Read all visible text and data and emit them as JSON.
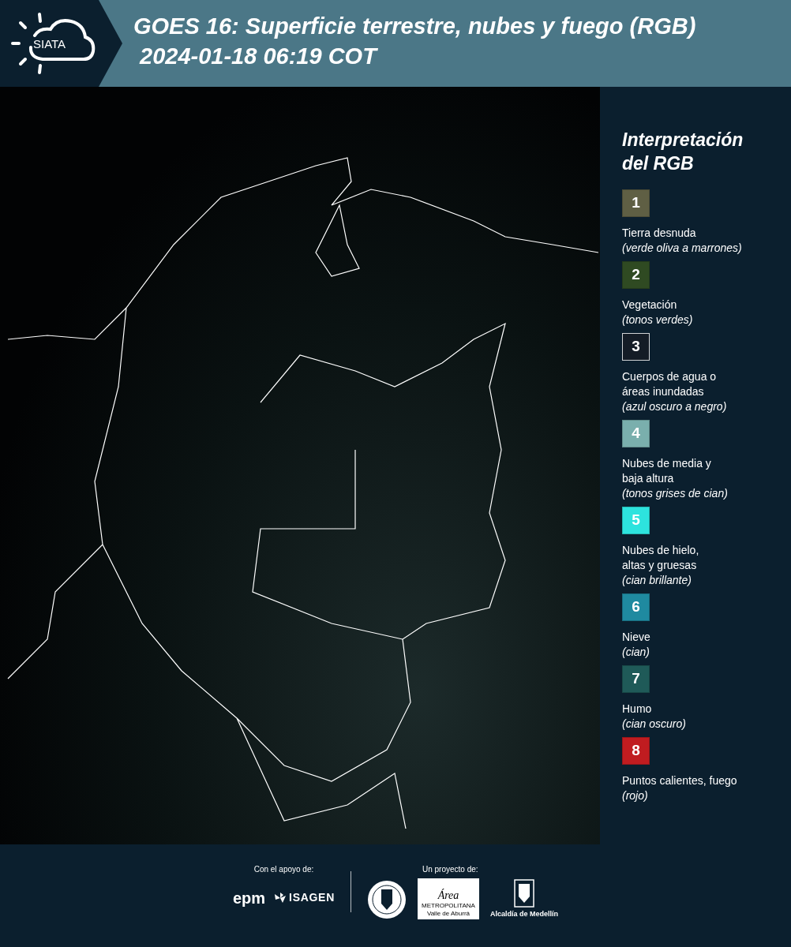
{
  "header": {
    "logo_text": "SIATA",
    "title": "GOES 16: Superficie terrestre, nubes y fuego (RGB)",
    "timestamp": "2024-01-18 06:19 COT"
  },
  "legend": {
    "title_lines": [
      "Interpretación",
      "del RGB"
    ],
    "items": [
      {
        "number": "1",
        "color": "#5f5f44",
        "outlined": false,
        "label_lines": [
          "Tierra desnuda"
        ],
        "note": "(verde oliva a marrones)"
      },
      {
        "number": "2",
        "color": "#2f4a22",
        "outlined": false,
        "label_lines": [
          "Vegetación"
        ],
        "note": "(tonos verdes)"
      },
      {
        "number": "3",
        "color": "#141c26",
        "outlined": true,
        "label_lines": [
          "Cuerpos de agua o",
          "áreas inundadas"
        ],
        "note": "(azul oscuro a negro)"
      },
      {
        "number": "4",
        "color": "#7aafad",
        "outlined": false,
        "label_lines": [
          "Nubes de media y",
          "baja altura"
        ],
        "note": "(tonos grises de cian)"
      },
      {
        "number": "5",
        "color": "#2de3de",
        "outlined": false,
        "label_lines": [
          "Nubes de hielo,",
          "altas y gruesas"
        ],
        "note": "(cian brillante)"
      },
      {
        "number": "6",
        "color": "#1f8aa0",
        "outlined": false,
        "label_lines": [
          "Nieve"
        ],
        "note": "(cian)"
      },
      {
        "number": "7",
        "color": "#1f5a58",
        "outlined": false,
        "label_lines": [
          "Humo"
        ],
        "note": "(cian oscuro)"
      },
      {
        "number": "8",
        "color": "#c01c20",
        "outlined": false,
        "label_lines": [
          "Puntos calientes, fuego"
        ],
        "note": "(rojo)"
      }
    ]
  },
  "footer": {
    "support_label": "Con el apoyo de:",
    "support_logos": [
      "epm",
      "ISAGEN"
    ],
    "project_label": "Un proyecto de:",
    "area_logo": [
      "Área",
      "METROPOLITANA",
      "Valle de Aburrá"
    ],
    "city_logo": "Alcaldía de Medellín"
  }
}
